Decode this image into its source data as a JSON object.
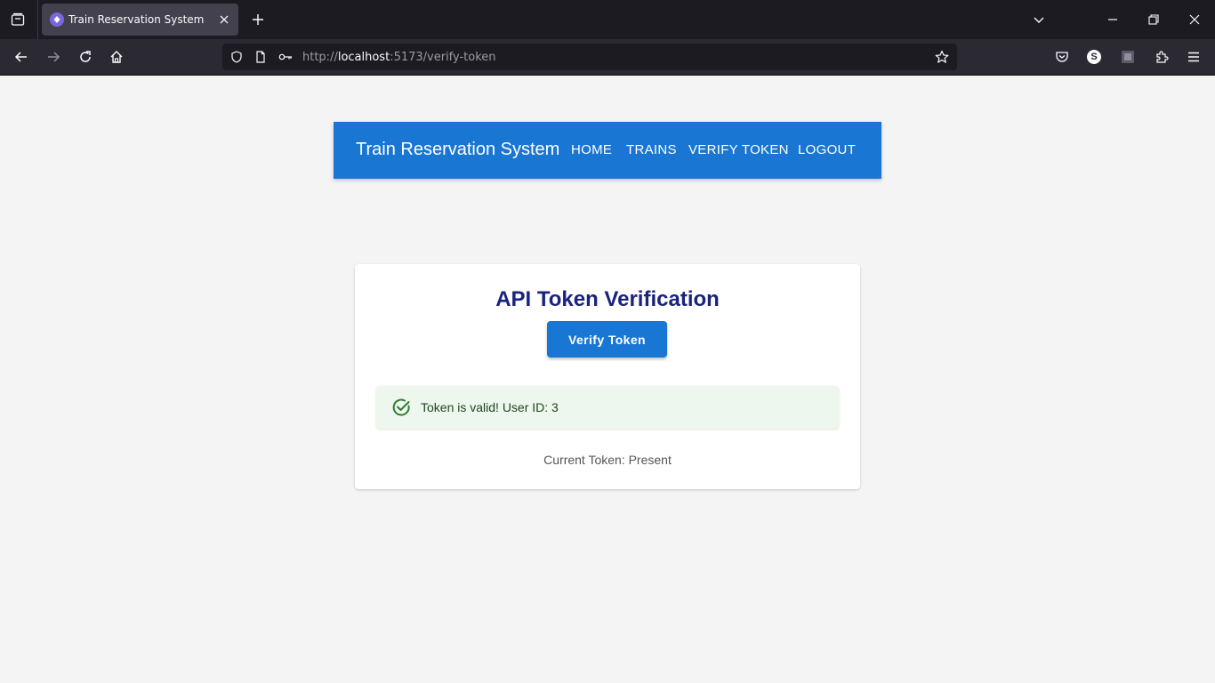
{
  "browser": {
    "tab_title": "Train Reservation System",
    "url_prefix": "http://",
    "url_host": "localhost",
    "url_rest": ":5173/verify-token",
    "profile_initial": "S"
  },
  "header": {
    "title": "Train Reservation System",
    "nav": [
      "HOME",
      "TRAINS",
      "VERIFY TOKEN",
      "LOGOUT"
    ]
  },
  "card": {
    "title": "API Token Verification",
    "button_label": "Verify Token",
    "alert_text": "Token is valid! User ID: 3",
    "token_status": "Current Token: Present"
  },
  "colors": {
    "primary": "#1976d2",
    "title": "#1a237e",
    "success_bg": "#edf7ed",
    "success_icon": "#2e7d32"
  }
}
